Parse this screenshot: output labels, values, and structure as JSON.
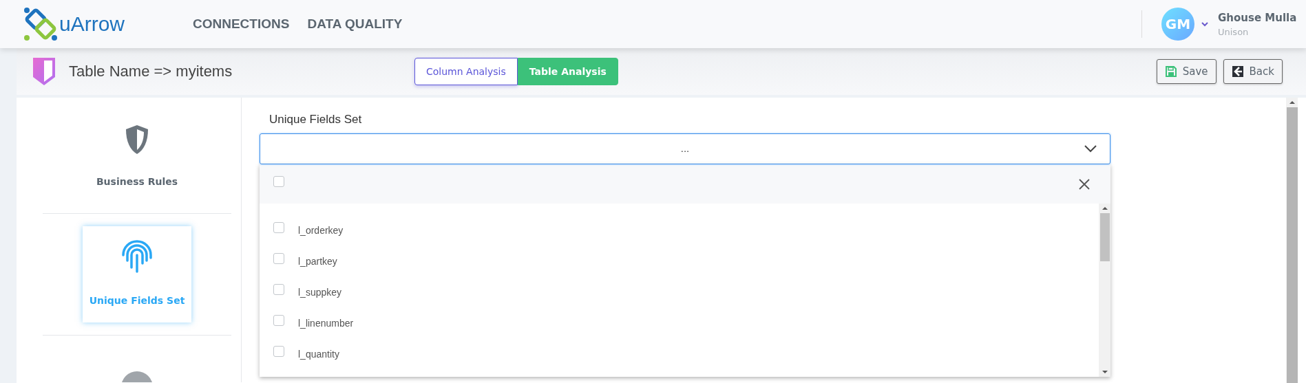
{
  "nav": [
    {
      "label": "CONNECTIONS"
    },
    {
      "label": "DATA QUALITY"
    }
  ],
  "logo": {
    "text": "uArrow"
  },
  "user": {
    "initials": "GM",
    "name": "Ghouse Mulla",
    "org": "Unison"
  },
  "page_title": "Table Name => myitems",
  "tabs": [
    {
      "label": "Column Analysis",
      "selected": false
    },
    {
      "label": "Table Analysis",
      "selected": true
    }
  ],
  "actions": [
    {
      "label": "Save",
      "kind": "save"
    },
    {
      "label": "Back",
      "kind": "back"
    }
  ],
  "sidebar": {
    "items": [
      {
        "label": "Business Rules",
        "kind": "shield",
        "selected": false
      },
      {
        "label": "Unique Fields Set",
        "kind": "fingerprint",
        "selected": true
      }
    ]
  },
  "field": {
    "label": "Unique Fields Set",
    "value": "...",
    "expanded": true,
    "select_all_checked": false,
    "options": [
      {
        "label": "l_orderkey",
        "checked": false
      },
      {
        "label": "l_partkey",
        "checked": false
      },
      {
        "label": "l_suppkey",
        "checked": false
      },
      {
        "label": "l_linenumber",
        "checked": false
      },
      {
        "label": "l_quantity",
        "checked": false
      }
    ]
  }
}
